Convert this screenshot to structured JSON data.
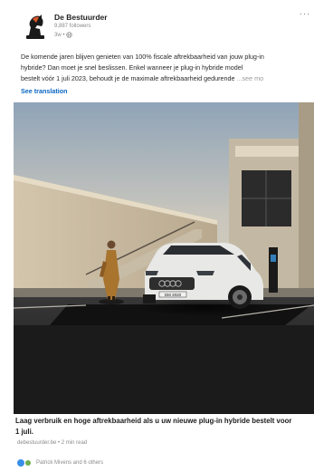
{
  "post": {
    "author": "De Bestuurder",
    "followers": "9,887 followers",
    "time": "3w •",
    "body_lines": [
      "De komende jaren blijven genieten van 100% fiscale aftrekbaarheid van jouw plug-in",
      "hybride? Dan moet je snel beslissen. Enkel wanneer je plug-in hybride model",
      "bestelt vóór 1 juli 2023, behoudt je de maximale aftrekbaarheid gedurende"
    ],
    "see_more": "...see mo",
    "see_translation": "See translation",
    "more_label": "···"
  },
  "link": {
    "headline_lines": [
      "Laag verbruik en hoge aftrekbaarheid als u uw nieuwe plug-in hybride bestelt voor",
      "1 juli."
    ],
    "source": "debestuurder.be • 2 min read"
  },
  "reactions": {
    "text": "Patrick Mivens and 6 others"
  },
  "photo": {
    "license_plate": "DM 2020"
  },
  "colors": {
    "link_blue": "#0a66c2",
    "like_blue": "#378fe9",
    "celebrate_green": "#6dae4f"
  },
  "icons": {
    "avatar": "knight-chess-piece-icon",
    "visibility": "globe-icon",
    "more": "ellipsis-icon"
  }
}
